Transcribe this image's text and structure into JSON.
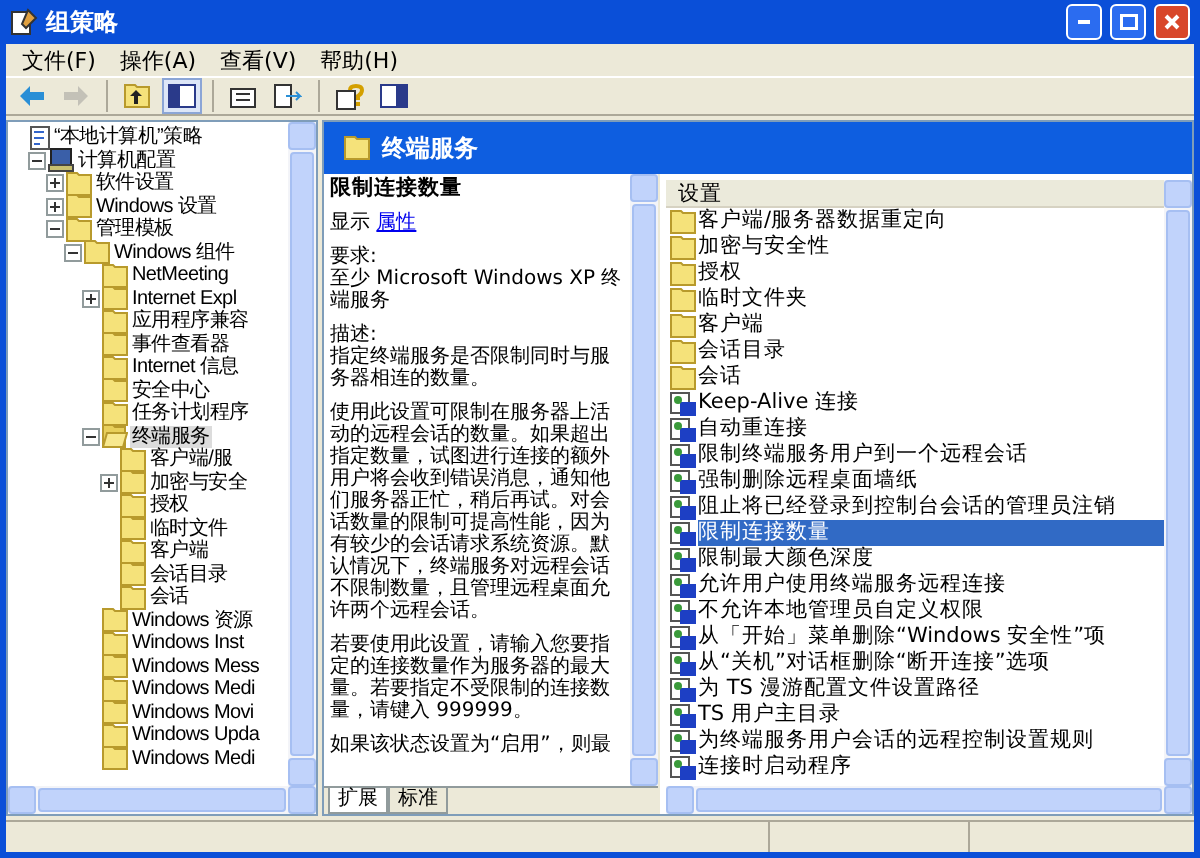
{
  "window": {
    "title": "组策略"
  },
  "menu": [
    "文件(F)",
    "操作(A)",
    "查看(V)",
    "帮助(H)"
  ],
  "toolbar": [
    {
      "kind": "back",
      "disabled": false,
      "pressed": false
    },
    {
      "kind": "forward",
      "disabled": true,
      "pressed": false
    },
    {
      "kind": "sep"
    },
    {
      "kind": "up",
      "disabled": false,
      "pressed": false
    },
    {
      "kind": "tree",
      "disabled": false,
      "pressed": true
    },
    {
      "kind": "sep"
    },
    {
      "kind": "properties",
      "disabled": false,
      "pressed": false
    },
    {
      "kind": "export",
      "disabled": false,
      "pressed": false
    },
    {
      "kind": "sep"
    },
    {
      "kind": "help",
      "disabled": false,
      "pressed": false
    },
    {
      "kind": "pane",
      "disabled": false,
      "pressed": false
    }
  ],
  "tree": [
    {
      "label": "“本地计算机”策略",
      "selected": false,
      "children": [
        {
          "label": "计算机配置",
          "expanded": true,
          "selected": false,
          "children": [
            {
              "label": "软件设置",
              "expanded": false,
              "selected": false
            },
            {
              "label": "Windows 设置",
              "expanded": false,
              "selected": false
            },
            {
              "label": "管理模板",
              "expanded": true,
              "selected": false,
              "children": [
                {
                  "label": "Windows 组件",
                  "expanded": true,
                  "selected": false,
                  "children": [
                    {
                      "label": "NetMeeting",
                      "selected": false
                    },
                    {
                      "label": "Internet Expl",
                      "expanded": false,
                      "selected": false
                    },
                    {
                      "label": "应用程序兼容",
                      "selected": false
                    },
                    {
                      "label": "事件查看器",
                      "selected": false
                    },
                    {
                      "label": "Internet 信息",
                      "selected": false
                    },
                    {
                      "label": "安全中心",
                      "selected": false
                    },
                    {
                      "label": "任务计划程序",
                      "selected": false
                    },
                    {
                      "label": "终端服务",
                      "expanded": true,
                      "selected": true,
                      "children": [
                        {
                          "label": "客户端/服",
                          "selected": false
                        },
                        {
                          "label": "加密与安全",
                          "expanded": false,
                          "selected": false
                        },
                        {
                          "label": "授权",
                          "selected": false
                        },
                        {
                          "label": "临时文件",
                          "selected": false
                        },
                        {
                          "label": "客户端",
                          "selected": false
                        },
                        {
                          "label": "会话目录",
                          "selected": false
                        },
                        {
                          "label": "会话",
                          "selected": false
                        }
                      ]
                    },
                    {
                      "label": "Windows 资源",
                      "selected": false
                    },
                    {
                      "label": "Windows Inst",
                      "selected": false
                    },
                    {
                      "label": "Windows Mess",
                      "selected": false
                    },
                    {
                      "label": "Windows Medi",
                      "selected": false
                    },
                    {
                      "label": "Windows Movi",
                      "selected": false
                    },
                    {
                      "label": "Windows Upda",
                      "selected": false
                    },
                    {
                      "label": "Windows Medi",
                      "selected": false
                    }
                  ]
                }
              ]
            }
          ]
        }
      ]
    }
  ],
  "header": {
    "title": "终端服务"
  },
  "description": {
    "title": "限制连接数量",
    "show_label": "显示",
    "show_link": "属性",
    "paragraphs": [
      "要求:\n至少 Microsoft Windows XP 终端服务",
      "描述:\n指定终端服务是否限制同时与服务器相连的数量。",
      "使用此设置可限制在服务器上活动的远程会话的数量。如果超出指定数量，试图进行连接的额外用户将会收到错误消息，通知他们服务器正忙，稍后再试。对会话数量的限制可提高性能，因为有较少的会话请求系统资源。默认情况下，终端服务对远程会话不限制数量，且管理远程桌面允许两个远程会话。",
      "若要使用此设置，请输入您要指定的连接数量作为服务器的最大量。若要指定不受限制的连接数量，请键入 999999。",
      "如果该状态设置为“启用”，则最"
    ]
  },
  "tabs": [
    {
      "label": "扩展",
      "selected": true
    },
    {
      "label": "标准",
      "selected": false
    }
  ],
  "list": {
    "column": "设置",
    "items": [
      {
        "label": "客户端/服务器数据重定向",
        "kind": "folder",
        "selected": false
      },
      {
        "label": "加密与安全性",
        "kind": "folder",
        "selected": false
      },
      {
        "label": "授权",
        "kind": "folder",
        "selected": false
      },
      {
        "label": "临时文件夹",
        "kind": "folder",
        "selected": false
      },
      {
        "label": "客户端",
        "kind": "folder",
        "selected": false
      },
      {
        "label": "会话目录",
        "kind": "folder",
        "selected": false
      },
      {
        "label": "会话",
        "kind": "folder",
        "selected": false
      },
      {
        "label": "Keep-Alive 连接",
        "kind": "setting",
        "selected": false
      },
      {
        "label": "自动重连接",
        "kind": "setting",
        "selected": false
      },
      {
        "label": "限制终端服务用户到一个远程会话",
        "kind": "setting",
        "selected": false
      },
      {
        "label": "强制删除远程桌面墙纸",
        "kind": "setting",
        "selected": false
      },
      {
        "label": "阻止将已经登录到控制台会话的管理员注销",
        "kind": "setting",
        "selected": false
      },
      {
        "label": "限制连接数量",
        "kind": "setting",
        "selected": true
      },
      {
        "label": "限制最大颜色深度",
        "kind": "setting",
        "selected": false
      },
      {
        "label": "允许用户使用终端服务远程连接",
        "kind": "setting",
        "selected": false
      },
      {
        "label": "不允许本地管理员自定义权限",
        "kind": "setting",
        "selected": false
      },
      {
        "label": "从「开始」菜单删除“Windows 安全性”项",
        "kind": "setting",
        "selected": false
      },
      {
        "label": "从“关机”对话框删除“断开连接”选项",
        "kind": "setting",
        "selected": false
      },
      {
        "label": "为 TS 漫游配置文件设置路径",
        "kind": "setting",
        "selected": false
      },
      {
        "label": "TS 用户主目录",
        "kind": "setting",
        "selected": false
      },
      {
        "label": "为终端服务用户会话的远程控制设置规则",
        "kind": "setting",
        "selected": false
      },
      {
        "label": "连接时启动程序",
        "kind": "setting",
        "selected": false
      }
    ]
  }
}
